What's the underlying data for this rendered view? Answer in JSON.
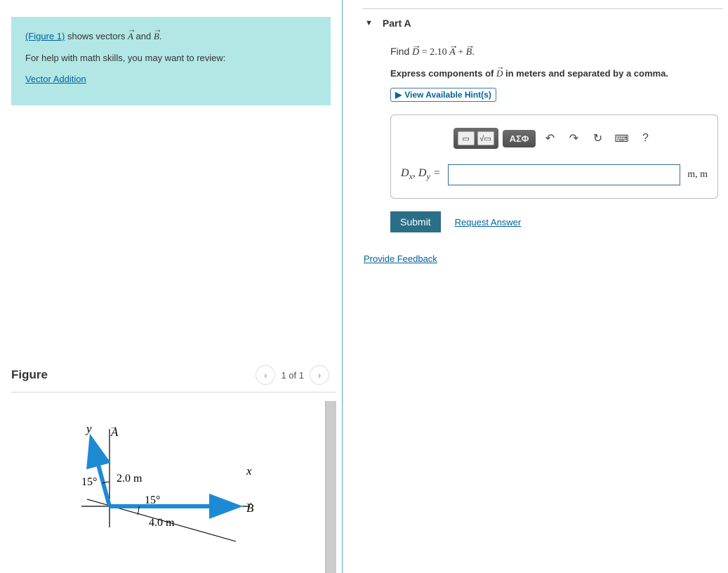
{
  "left": {
    "info": {
      "figure_link": "(Figure 1)",
      "shows_text": " shows vectors ",
      "vecA": "A",
      "and_text": " and ",
      "vecB": "B",
      "period": ".",
      "help_text": "For help with math skills, you may want to review:",
      "review_link": "Vector Addition"
    },
    "figure": {
      "title": "Figure",
      "pager": "1 of 1",
      "labels": {
        "y": "y",
        "x": "x",
        "A": "A",
        "B": "B",
        "A_len": "2.0 m",
        "B_len": "4.0 m",
        "A_angle": "15°",
        "B_angle": "15°"
      }
    }
  },
  "right": {
    "part_label": "Part A",
    "find_prefix": "Find ",
    "vecD": "D",
    "equals": " = 2.10 ",
    "vecA": "A",
    "plus": " + ",
    "vecB": "B",
    "period": ".",
    "express_prefix": "Express components of ",
    "express_suffix": " in meters and separated by a comma.",
    "hints_label": "View Available Hint(s)",
    "toolbar": {
      "greek": "ΑΣΦ",
      "undo": "↶",
      "redo": "↷",
      "reset": "↻",
      "keyboard": "⌨",
      "help": "?"
    },
    "answer_label_Dx": "D",
    "answer_sub_x": "x",
    "comma": ", ",
    "answer_label_Dy": "D",
    "answer_sub_y": "y",
    "equals_sign": " =",
    "units": "m, m",
    "submit": "Submit",
    "request": "Request Answer",
    "feedback": "Provide Feedback"
  },
  "chart_data": {
    "type": "vector-diagram",
    "vectors": [
      {
        "name": "A",
        "magnitude_m": 2.0,
        "angle_deg_from_positive_y_axis": 15,
        "direction_note": "15° from +y toward -x (into second quadrant from y-axis)"
      },
      {
        "name": "B",
        "magnitude_m": 4.0,
        "angle_deg_from_positive_x_axis": 0,
        "note": "along +x; a guide line at 15° below x-axis is also drawn"
      }
    ],
    "axes": [
      "x",
      "y"
    ],
    "angles_labeled": [
      {
        "label": "15°",
        "between": [
          "A",
          "+y axis"
        ]
      },
      {
        "label": "15°",
        "between": [
          "+x axis",
          "guide line below x"
        ]
      }
    ]
  }
}
